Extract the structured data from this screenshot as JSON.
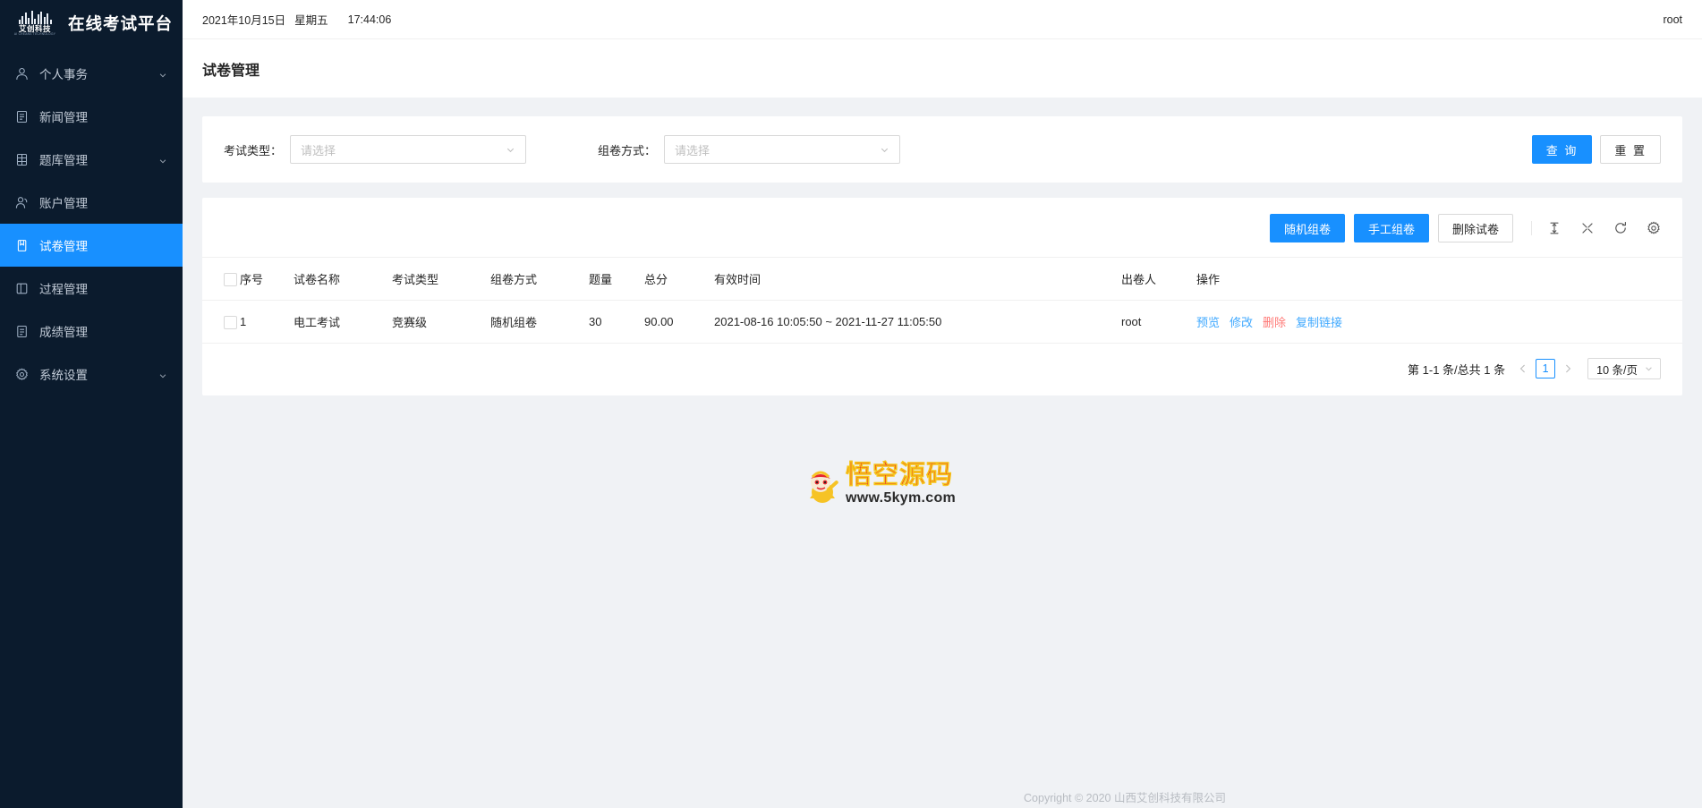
{
  "brand": {
    "cn_mark": "艾创科技",
    "en_mark": "AI CREANS TECHNOLOGY",
    "title": "在线考试平台"
  },
  "sidebar": {
    "items": [
      {
        "label": "个人事务",
        "icon": "user-icon",
        "expandable": true,
        "active": false
      },
      {
        "label": "新闻管理",
        "icon": "news-file-icon",
        "expandable": false,
        "active": false
      },
      {
        "label": "题库管理",
        "icon": "database-icon",
        "expandable": true,
        "active": false
      },
      {
        "label": "账户管理",
        "icon": "user-group-icon",
        "expandable": false,
        "active": false
      },
      {
        "label": "试卷管理",
        "icon": "paper-icon",
        "expandable": false,
        "active": true
      },
      {
        "label": "过程管理",
        "icon": "layout-icon",
        "expandable": false,
        "active": false
      },
      {
        "label": "成绩管理",
        "icon": "score-file-icon",
        "expandable": false,
        "active": false
      },
      {
        "label": "系统设置",
        "icon": "gear-icon",
        "expandable": true,
        "active": false
      }
    ]
  },
  "topbar": {
    "date": "2021年10月15日",
    "weekday": "星期五",
    "time": "17:44:06",
    "user": "root"
  },
  "page": {
    "title": "试卷管理"
  },
  "filters": {
    "exam_type": {
      "label": "考试类型：",
      "placeholder": "请选择",
      "value": ""
    },
    "compose_mode": {
      "label": "组卷方式：",
      "placeholder": "请选择",
      "value": ""
    },
    "query_label": "查 询",
    "reset_label": "重 置"
  },
  "toolbar": {
    "random_label": "随机组卷",
    "manual_label": "手工组卷",
    "delete_label": "删除试卷",
    "icons": [
      {
        "name": "density-icon"
      },
      {
        "name": "fullscreen-icon"
      },
      {
        "name": "reload-icon"
      },
      {
        "name": "setting-gear-icon"
      }
    ]
  },
  "table": {
    "headers": [
      "序号",
      "试卷名称",
      "考试类型",
      "组卷方式",
      "题量",
      "总分",
      "有效时间",
      "出卷人",
      "操作"
    ],
    "rows": [
      {
        "index": "1",
        "name": "电工考试",
        "exam_type": "竞赛级",
        "mode": "随机组卷",
        "question_count": "30",
        "total_score": "90.00",
        "valid_time": "2021-08-16 10:05:50 ~ 2021-11-27 11:05:50",
        "author": "root",
        "actions": [
          {
            "label": "预览",
            "tone": "blue"
          },
          {
            "label": "修改",
            "tone": "blue"
          },
          {
            "label": "删除",
            "tone": "red"
          },
          {
            "label": "复制链接",
            "tone": "blue"
          }
        ]
      }
    ]
  },
  "pagination": {
    "total_text": "第 1-1 条/总共 1 条",
    "current_page": "1",
    "page_size_label": "10 条/页"
  },
  "watermark": {
    "text": "悟空源码",
    "url": "www.5kym.com"
  },
  "footer": {
    "text": "Copyright © 2020 山西艾创科技有限公司"
  },
  "colors": {
    "accent": "#1890ff",
    "sidebar_bg": "#0b1b2d",
    "danger": "#ff7875",
    "link": "#40a9ff"
  }
}
